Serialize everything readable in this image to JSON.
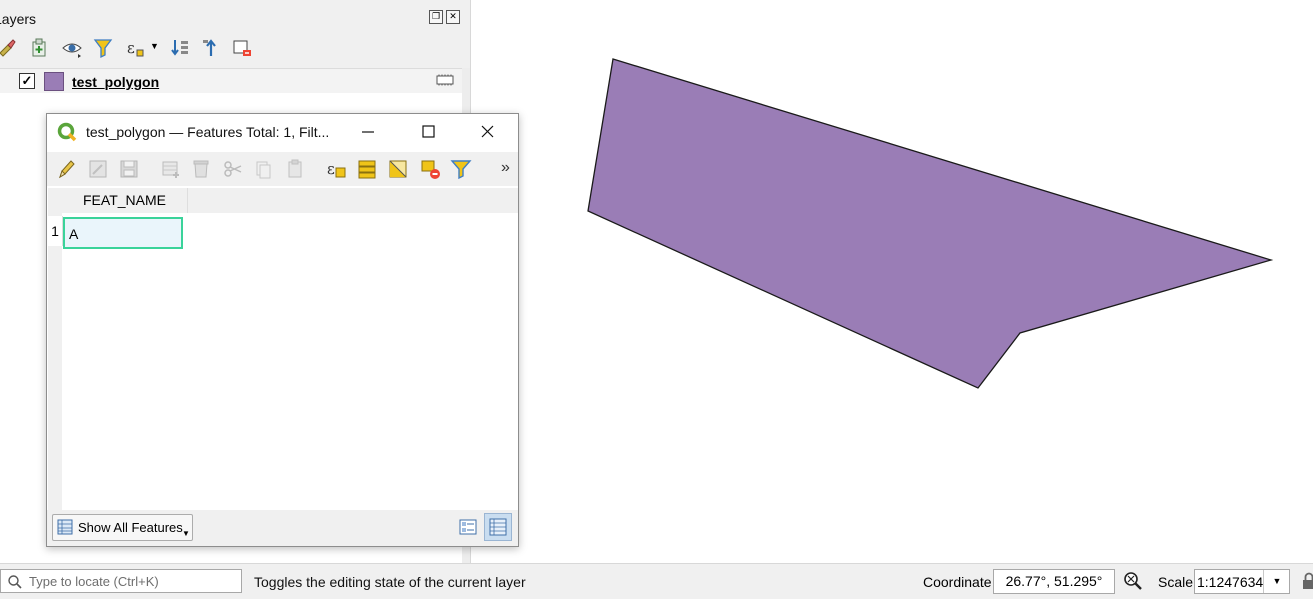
{
  "layers_panel": {
    "title": "Layers",
    "float_icon": "float-panel-icon",
    "close_icon": "close-panel-icon",
    "toolbar_icons": [
      "style-brush-icon",
      "add-group-icon",
      "visibility-eye-icon",
      "filter-funnel-icon",
      "expression-filter-icon",
      "expand-all-icon",
      "collapse-all-icon",
      "remove-layer-icon"
    ],
    "layer": {
      "name": "test_polygon",
      "checked": "✓",
      "swatch_color": "#9a7db6",
      "editing_icon": "editing-mode-icon"
    }
  },
  "map": {
    "fill_color": "#9a7db6",
    "stroke_color": "#1a1a1a"
  },
  "attribute_window": {
    "title": "test_polygon — Features Total: 1, Filt...",
    "toolbar_icons": [
      "toggle-editing-icon",
      "multi-edit-icon",
      "save-edits-icon",
      "add-feature-icon",
      "delete-feature-icon",
      "cut-icon",
      "copy-icon",
      "paste-icon",
      "select-by-expression-icon",
      "select-all-icon",
      "invert-selection-icon",
      "deselect-all-icon",
      "filter-selection-icon"
    ],
    "more_label": "»",
    "column_header": "FEAT_NAME",
    "rows": [
      {
        "number": "1",
        "feat_name": "A"
      }
    ],
    "show_all_label": "Show All Features"
  },
  "status_bar": {
    "locator_placeholder": "Type to locate (Ctrl+K)",
    "message": "Toggles the editing state of the current layer",
    "coordinate_label": "Coordinate",
    "coordinate_value": "26.77°, 51.295°",
    "scale_label": "Scale",
    "scale_value": "1:1247634"
  }
}
